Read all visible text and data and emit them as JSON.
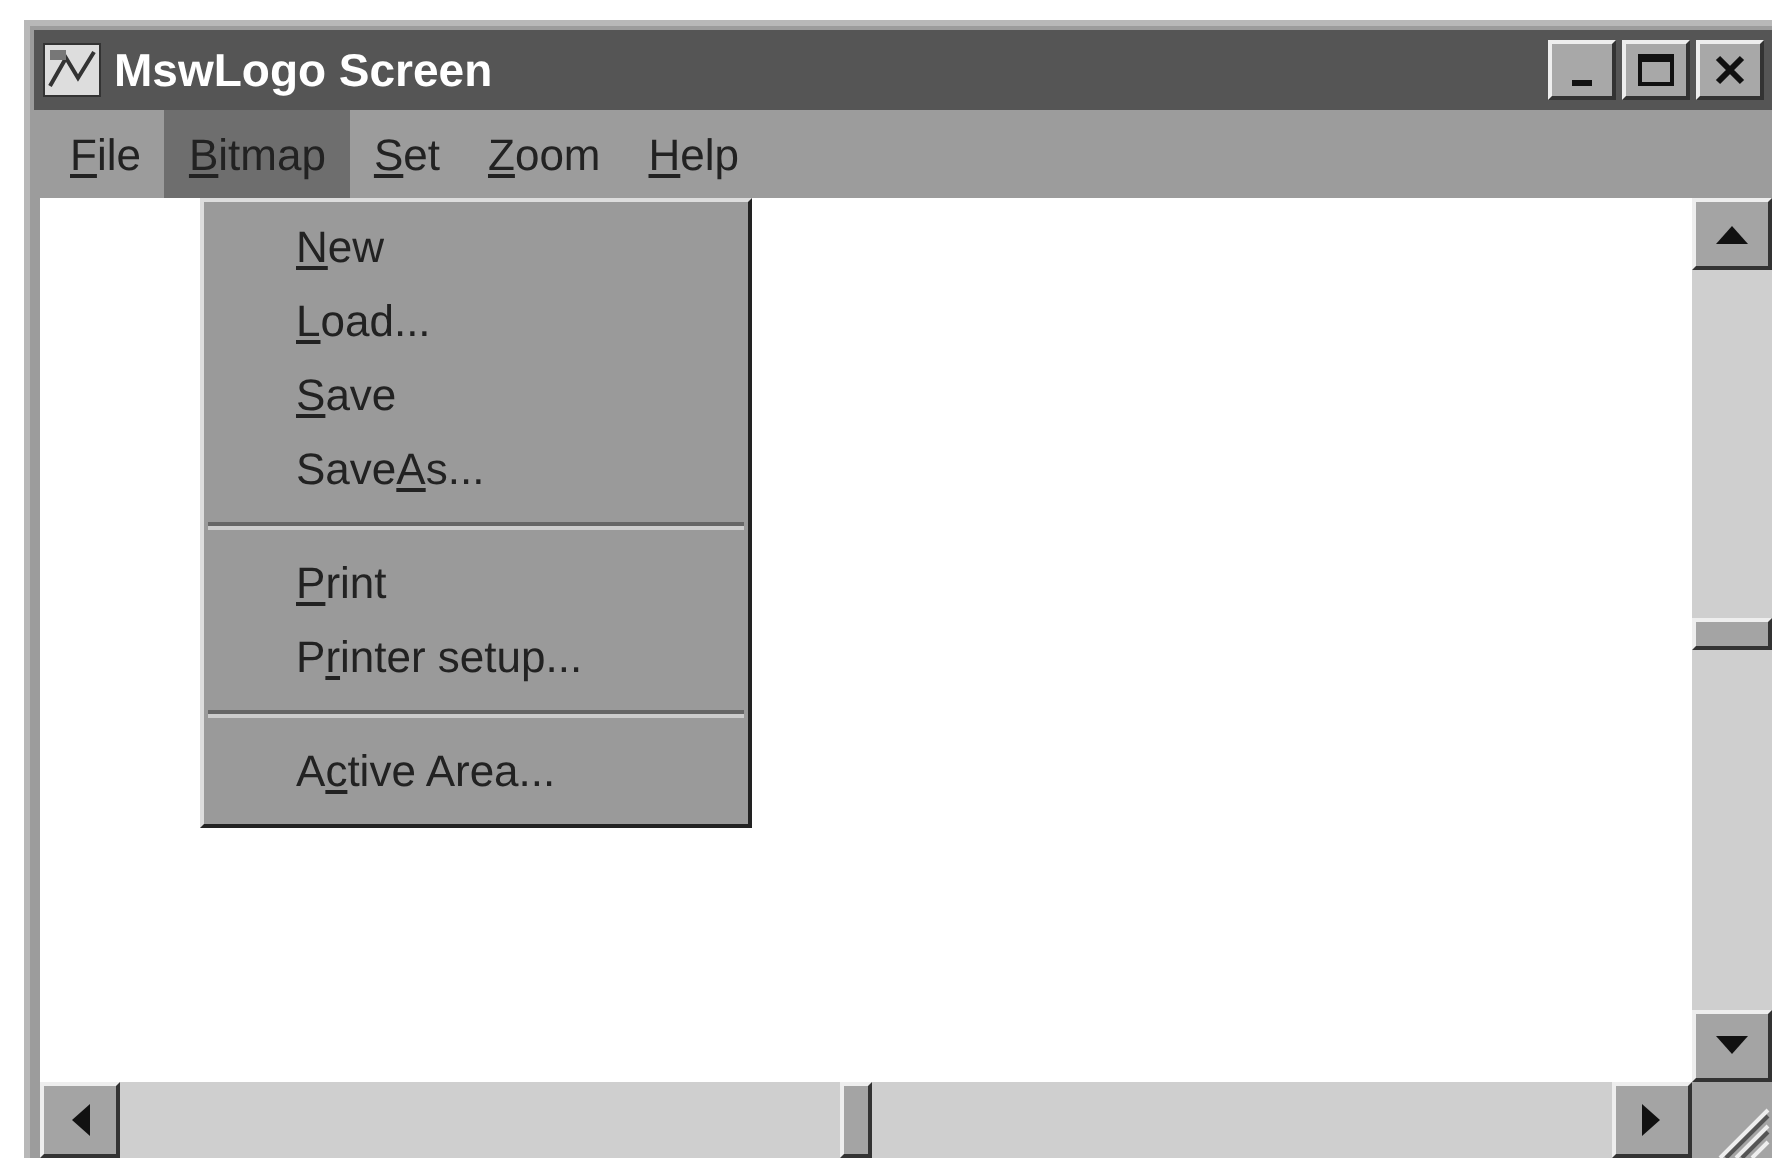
{
  "window": {
    "title": "MswLogo Screen"
  },
  "menu_bar": [
    {
      "key": "F",
      "after": "ile",
      "selected": false
    },
    {
      "key": "B",
      "after": "itmap",
      "selected": true
    },
    {
      "key": "S",
      "after": "et",
      "selected": false
    },
    {
      "key": "Z",
      "after": "oom",
      "selected": false
    },
    {
      "key": "H",
      "after": "elp",
      "selected": false
    }
  ],
  "dropdown": {
    "items": [
      {
        "kind": "item",
        "key": "N",
        "after": "ew"
      },
      {
        "kind": "item",
        "key": "L",
        "after": "oad..."
      },
      {
        "kind": "item",
        "key": "S",
        "after": "ave"
      },
      {
        "kind": "item",
        "before": "Save",
        "key": "A",
        "after": "s..."
      },
      {
        "kind": "separator"
      },
      {
        "kind": "item",
        "key": "P",
        "after": "rint"
      },
      {
        "kind": "item",
        "before": "P",
        "key": "r",
        "after": "inter setup..."
      },
      {
        "kind": "separator"
      },
      {
        "kind": "item",
        "before": "A",
        "key": "c",
        "after": "tive Area..."
      }
    ]
  }
}
